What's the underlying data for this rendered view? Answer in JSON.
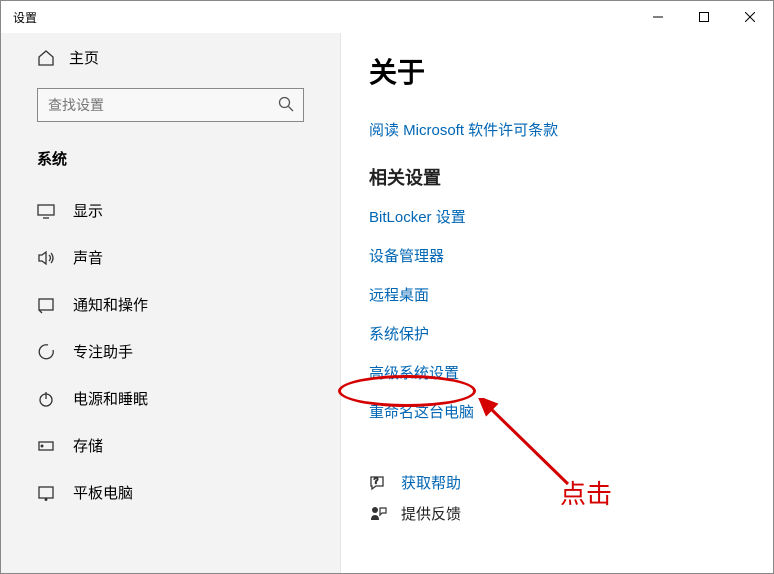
{
  "window": {
    "title": "设置"
  },
  "sidebar": {
    "home": "主页",
    "search_placeholder": "查找设置",
    "section": "系统",
    "items": [
      {
        "label": "显示",
        "icon": "display-icon"
      },
      {
        "label": "声音",
        "icon": "sound-icon"
      },
      {
        "label": "通知和操作",
        "icon": "notification-icon"
      },
      {
        "label": "专注助手",
        "icon": "focus-icon"
      },
      {
        "label": "电源和睡眠",
        "icon": "power-icon"
      },
      {
        "label": "存储",
        "icon": "storage-icon"
      },
      {
        "label": "平板电脑",
        "icon": "tablet-icon"
      }
    ]
  },
  "content": {
    "title": "关于",
    "license_link": "阅读 Microsoft 软件许可条款",
    "related_title": "相关设置",
    "links": [
      "BitLocker 设置",
      "设备管理器",
      "远程桌面",
      "系统保护",
      "高级系统设置",
      "重命名这台电脑"
    ],
    "help": "获取帮助",
    "feedback": "提供反馈"
  },
  "annotation": {
    "label": "点击"
  }
}
